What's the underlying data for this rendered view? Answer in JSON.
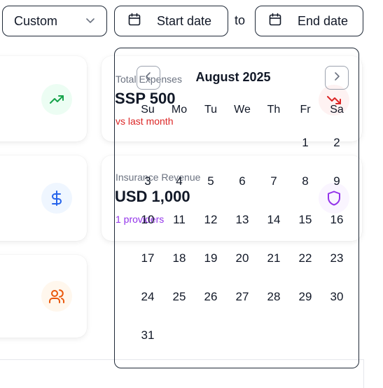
{
  "filters": {
    "period_select": "Custom",
    "start_date": "Start date",
    "to_label": "to",
    "end_date": "End date"
  },
  "cards": {
    "total_expenses": {
      "label": "Total Expenses",
      "value": "SSP 500",
      "sub": "vs last month"
    },
    "insurance_revenue": {
      "label": "Insurance Revenue",
      "value": "USD 1,000",
      "sub": "1 providers"
    }
  },
  "calendar": {
    "month": "August 2025",
    "weekdays": [
      "Su",
      "Mo",
      "Tu",
      "We",
      "Th",
      "Fr",
      "Sa"
    ],
    "days": [
      "1",
      "2",
      "3",
      "4",
      "5",
      "6",
      "7",
      "8",
      "9",
      "10",
      "11",
      "12",
      "13",
      "14",
      "15",
      "16",
      "17",
      "18",
      "19",
      "20",
      "21",
      "22",
      "23",
      "24",
      "25",
      "26",
      "27",
      "28",
      "29",
      "30",
      "31"
    ]
  },
  "colors": {
    "green": "#16a34a",
    "red": "#dc2626",
    "blue": "#2563eb",
    "purple": "#9333ea",
    "orange": "#ea580c"
  }
}
